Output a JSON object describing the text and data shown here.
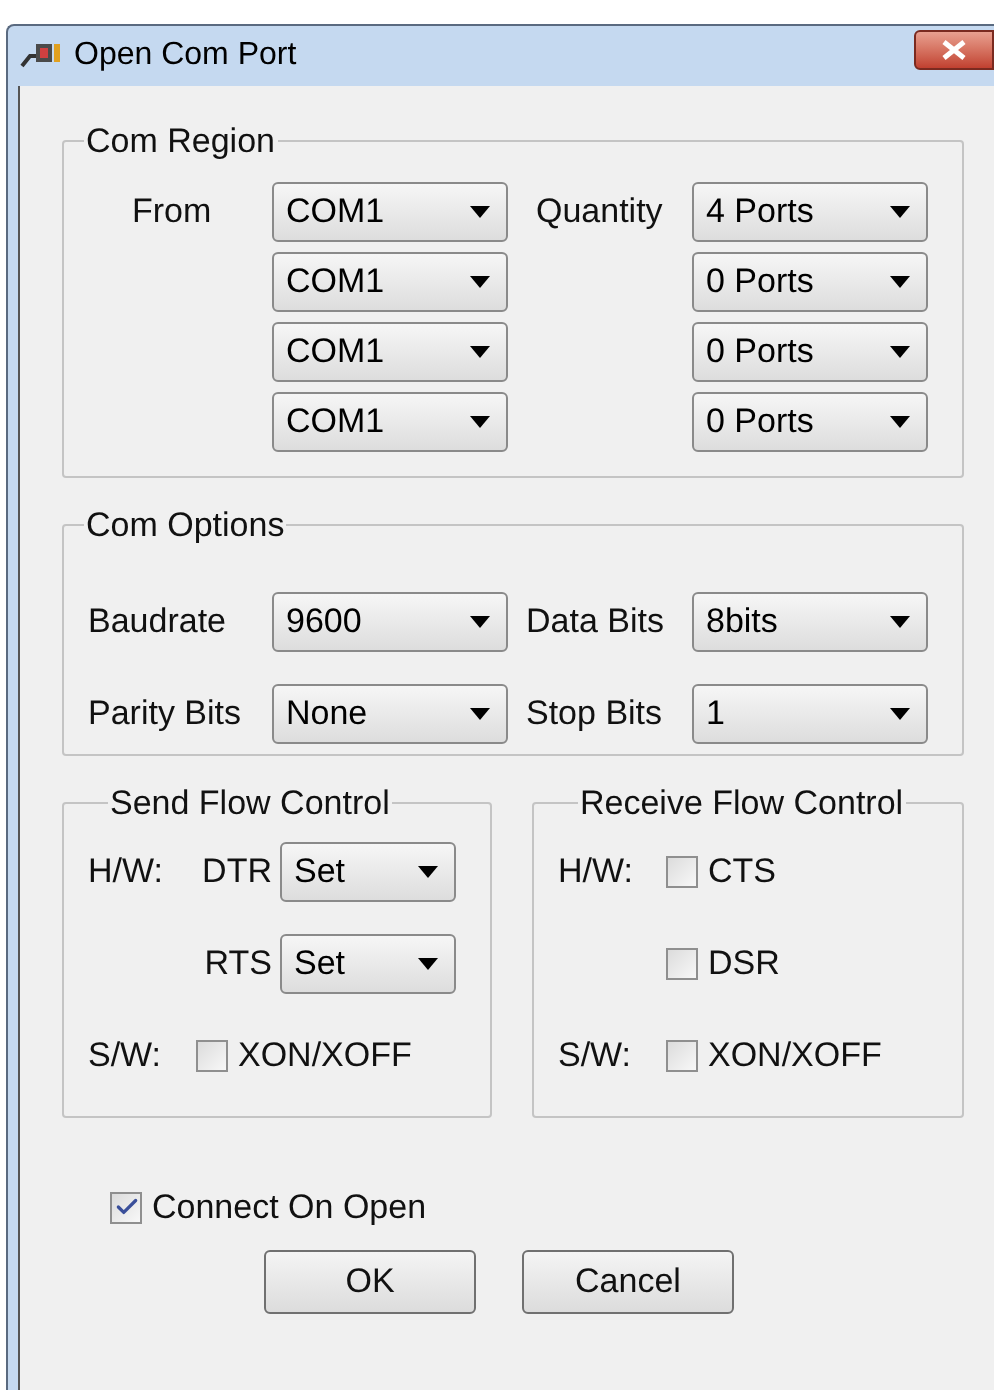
{
  "window": {
    "title": "Open Com Port"
  },
  "com_region": {
    "legend": "Com Region",
    "from_label": "From",
    "quantity_label": "Quantity",
    "rows": [
      {
        "port": "COM1",
        "quantity": "4 Ports"
      },
      {
        "port": "COM1",
        "quantity": "0 Ports"
      },
      {
        "port": "COM1",
        "quantity": "0 Ports"
      },
      {
        "port": "COM1",
        "quantity": "0 Ports"
      }
    ]
  },
  "com_options": {
    "legend": "Com Options",
    "rows": [
      [
        {
          "label": "Baudrate",
          "value": "9600"
        },
        {
          "label": "Data Bits",
          "value": "8bits"
        }
      ],
      [
        {
          "label": "Parity Bits",
          "value": "None"
        },
        {
          "label": "Stop Bits",
          "value": "1"
        }
      ]
    ]
  },
  "send_flow_control": {
    "legend": "Send Flow Control",
    "rows": [
      {
        "prefix": "H/W:",
        "kind": "select",
        "label": "DTR",
        "value": "Set"
      },
      {
        "kind": "select",
        "label": "RTS",
        "value": "Set"
      },
      {
        "prefix": "S/W:",
        "kind": "checkbox",
        "label": "XON/XOFF",
        "checked": false
      }
    ]
  },
  "receive_flow_control": {
    "legend": "Receive Flow Control",
    "rows": [
      {
        "prefix": "H/W:",
        "kind": "checkbox",
        "label": "CTS",
        "checked": false
      },
      {
        "kind": "checkbox",
        "label": "DSR",
        "checked": false
      },
      {
        "prefix": "S/W:",
        "kind": "checkbox",
        "label": "XON/XOFF",
        "checked": false
      }
    ]
  },
  "connect_on_open": {
    "label": "Connect On Open",
    "checked": true
  },
  "buttons": [
    "OK",
    "Cancel"
  ]
}
